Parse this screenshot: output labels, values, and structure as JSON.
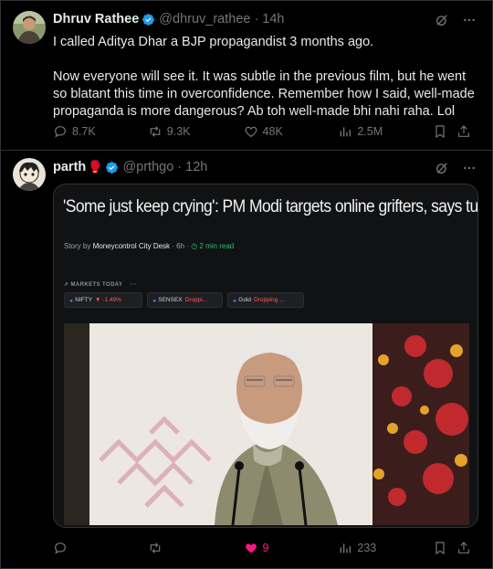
{
  "tweet1": {
    "name": "Dhruv Rathee",
    "handle": "@dhruv_rathee",
    "separator": "·",
    "time": "14h",
    "paragraphs": [
      "I called Aditya Dhar a BJP propagandist 3 months ago.",
      "Now everyone will see it. It was subtle in the previous film, but he went so blatant this time in overconfidence. Remember how I said, well-made propaganda is more dangerous? Ab toh well-made bhi nahi raha. Lol"
    ],
    "replies": "8.7K",
    "reposts": "9.3K",
    "likes": "48K",
    "views": "2.5M"
  },
  "tweet2": {
    "name": "parth",
    "handle": "@prthgo",
    "separator": "·",
    "time": "12h",
    "likes": "9",
    "views": "233",
    "like_color": "#f91880"
  },
  "article": {
    "headline": "'Some just keep crying': PM Modi targets online grifters, says tum logo ki MKC",
    "byline_prefix": "Story by",
    "byline_source": "Moneycontrol City Desk",
    "byline_time": "· 6h ·",
    "read_time": "2 min read",
    "markets_title": "MARKETS TODAY",
    "markets_more": "···",
    "chips": [
      {
        "name": "NIFTY",
        "change": "▼ -1.49%"
      },
      {
        "name": "SENSEX",
        "change": "Droppi..."
      },
      {
        "name": "Gold",
        "change": "Dropping ..."
      }
    ]
  },
  "colors": {
    "accent": "#1d9bf0",
    "muted": "#71767b",
    "like": "#f91880",
    "background": "#000000"
  },
  "icons": [
    "verified-badge-icon",
    "grok-icon",
    "more-icon",
    "reply-icon",
    "repost-icon",
    "like-icon",
    "views-icon",
    "bookmark-icon",
    "share-icon"
  ]
}
